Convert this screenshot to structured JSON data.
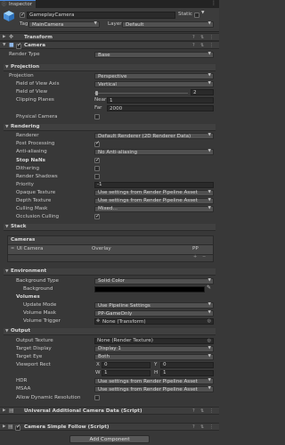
{
  "window": {
    "tab_label": "Inspector"
  },
  "header": {
    "object_name": "GameplayCamera",
    "static_label": "Static",
    "tag_label": "Tag",
    "tag_value": "MainCamera",
    "layer_label": "Layer",
    "layer_value": "Default"
  },
  "components": {
    "transform": "Transform",
    "camera": "Camera"
  },
  "camera": {
    "render_type_label": "Render Type",
    "render_type_value": "Base"
  },
  "projection": {
    "title": "Projection",
    "projection_label": "Projection",
    "projection_value": "Perspective",
    "fov_axis_label": "Field of View Axis",
    "fov_axis_value": "Vertical",
    "fov_label": "Field of View",
    "fov_value": "2",
    "fov_fraction": 0.012,
    "clipping_label": "Clipping Planes",
    "near_label": "Near",
    "near_value": "1",
    "far_label": "Far",
    "far_value": "2000",
    "physical_label": "Physical Camera"
  },
  "rendering": {
    "title": "Rendering",
    "renderer_label": "Renderer",
    "renderer_value": "Default Renderer (2D Renderer Data)",
    "post_label": "Post Processing",
    "aa_label": "Anti-aliasing",
    "aa_value": "No Anti-aliasing",
    "stopnans_label": "Stop NaNs",
    "dithering_label": "Dithering",
    "shadows_label": "Render Shadows",
    "priority_label": "Priority",
    "priority_value": "-1",
    "opaque_label": "Opaque Texture",
    "opaque_value": "Use settings from Render Pipeline Asset",
    "depth_label": "Depth Texture",
    "depth_value": "Use settings from Render Pipeline Asset",
    "culling_label": "Culling Mask",
    "culling_value": "Mixed...",
    "occlusion_label": "Occlusion Culling"
  },
  "stack": {
    "title": "Stack",
    "cameras_label": "Cameras",
    "cam_name": "UI Camera",
    "cam_type": "Overlay",
    "pp_label": "PP"
  },
  "environment": {
    "title": "Environment",
    "bg_type_label": "Background Type",
    "bg_type_value": "Solid Color",
    "bg_label": "Background",
    "volumes_label": "Volumes",
    "update_label": "Update Mode",
    "update_value": "Use Pipeline Settings",
    "mask_label": "Volume Mask",
    "mask_value": "PP-GameOnly",
    "trigger_label": "Volume Trigger",
    "trigger_value": "None (Transform)"
  },
  "output": {
    "title": "Output",
    "texture_label": "Output Texture",
    "texture_value": "None (Render Texture)",
    "display_label": "Target Display",
    "display_value": "Display 1",
    "eye_label": "Target Eye",
    "eye_value": "Both",
    "viewport_label": "Viewport Rect",
    "x_label": "X",
    "x_value": "0",
    "y_label": "Y",
    "y_value": "0",
    "w_label": "W",
    "w_value": "1",
    "h_label": "H",
    "h_value": "1",
    "hdr_label": "HDR",
    "hdr_value": "Use settings from Render Pipeline Asset",
    "msaa_label": "MSAA",
    "msaa_value": "Use settings from Render Pipeline Asset",
    "dynres_label": "Allow Dynamic Resolution"
  },
  "extra_components": {
    "additional": "Universal Additional Camera Data (Script)",
    "follow": "Camera Simple Follow (Script)"
  },
  "footer": {
    "add_component": "Add Component"
  }
}
